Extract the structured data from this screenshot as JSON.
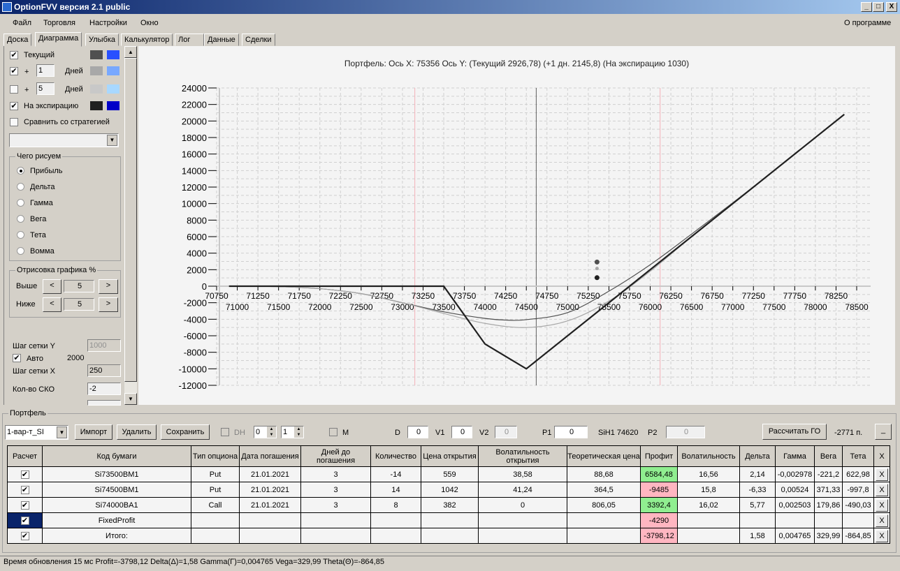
{
  "window": {
    "title": "OptionFVV версия 2.1 public",
    "min": "_",
    "max": "□",
    "close": "X"
  },
  "menu": [
    "Файл",
    "Торговля",
    "Настройки",
    "Окно"
  ],
  "menu_right": "О программе",
  "tabs": [
    "Доска",
    "Диаграмма",
    "Улыбка",
    "Калькулятор",
    "Лог",
    "Данные",
    "Сделки"
  ],
  "active_tab": "Диаграмма",
  "left": {
    "current": {
      "label": "Текущий",
      "checked": true,
      "color1": "#505050",
      "color2": "#2850ff"
    },
    "plus1": {
      "plus": "+",
      "value": "1",
      "unit": "Дней",
      "checked": true,
      "color1": "#a8a8a8",
      "color2": "#78a8ff"
    },
    "plus5": {
      "plus": "+",
      "value": "5",
      "unit": "Дней",
      "checked": false,
      "color1": "#c8c8c8",
      "color2": "#a8d8ff"
    },
    "expiry": {
      "label": "На экспирацию",
      "checked": true,
      "color1": "#202020",
      "color2": "#0000c8"
    },
    "compare": {
      "label": "Сравнить со стратегией",
      "checked": false
    },
    "what_title": "Чего рисуем",
    "what": [
      {
        "label": "Прибыль",
        "selected": true
      },
      {
        "label": "Дельта"
      },
      {
        "label": "Гамма"
      },
      {
        "label": "Вега"
      },
      {
        "label": "Тета"
      },
      {
        "label": "Вомма"
      }
    ],
    "draw_title": "Отрисовка графика %",
    "above": {
      "label": "Выше",
      "value": "5"
    },
    "below": {
      "label": "Ниже",
      "value": "5"
    },
    "prev": "<",
    "next": ">",
    "grid_y_label": "Шаг сетки Y",
    "grid_y": "1000",
    "auto_label": "Авто",
    "auto_value": "2000",
    "grid_x_label": "Шаг сетки X",
    "grid_x": "250",
    "sko_label": "Кол-во СКО",
    "sko": "-2"
  },
  "chart_data": {
    "type": "line",
    "title": "Портфель: Ось X: 75356 Ось Y:  (Текущий 2926,78)  (+1 дн. 2145,8)  (На экспирацию 1030)",
    "xlim": [
      70750,
      78500
    ],
    "ylim": [
      -12000,
      24000
    ],
    "xticks": [
      70750,
      71000,
      71250,
      71500,
      71750,
      72000,
      72250,
      72500,
      72750,
      73000,
      73250,
      73500,
      73750,
      74000,
      74250,
      74500,
      74750,
      75000,
      75250,
      75500,
      75750,
      76000,
      76250,
      76500,
      76750,
      77000,
      77250,
      77500,
      77750,
      78000,
      78250,
      78500
    ],
    "yticks": [
      24000,
      22000,
      20000,
      18000,
      16000,
      14000,
      12000,
      10000,
      8000,
      6000,
      4000,
      2000,
      0,
      -2000,
      -4000,
      -6000,
      -8000,
      -10000,
      -12000
    ],
    "grid": true,
    "series": [
      {
        "name": "Текущий",
        "color": "#505050",
        "points": [
          [
            70900,
            0
          ],
          [
            71500,
            -50
          ],
          [
            72000,
            -300
          ],
          [
            72500,
            -900
          ],
          [
            73000,
            -2000
          ],
          [
            73500,
            -3100
          ],
          [
            74000,
            -3900
          ],
          [
            74250,
            -4100
          ],
          [
            74500,
            -4050
          ],
          [
            75000,
            -3200
          ],
          [
            75500,
            -600
          ],
          [
            76000,
            2600
          ],
          [
            76500,
            6300
          ],
          [
            77000,
            10100
          ],
          [
            77500,
            14000
          ],
          [
            78350,
            20800
          ]
        ]
      },
      {
        "name": "+1 дн.",
        "color": "#a8a8a8",
        "points": [
          [
            70900,
            0
          ],
          [
            71500,
            -50
          ],
          [
            72000,
            -300
          ],
          [
            72500,
            -900
          ],
          [
            73000,
            -2000
          ],
          [
            73500,
            -3300
          ],
          [
            74000,
            -4500
          ],
          [
            74500,
            -5000
          ],
          [
            75000,
            -4200
          ],
          [
            75500,
            -1800
          ],
          [
            76000,
            1800
          ],
          [
            76500,
            6000
          ],
          [
            77000,
            10050
          ],
          [
            77500,
            14000
          ],
          [
            78350,
            20800
          ]
        ]
      },
      {
        "name": "На экспирацию",
        "color": "#202020",
        "points": [
          [
            70900,
            0
          ],
          [
            73500,
            0
          ],
          [
            74000,
            -7000
          ],
          [
            74500,
            -10000
          ],
          [
            78350,
            20800
          ]
        ]
      }
    ],
    "cursor": {
      "x": 75356,
      "values": [
        2926.78,
        2145.8,
        1030
      ]
    },
    "underlying_price": 74620,
    "bounds": [
      73150,
      76120
    ]
  },
  "portfolio": {
    "title": "Портфель",
    "selected": "1-вар-т_SI",
    "import": "Импорт",
    "delete": "Удалить",
    "save": "Сохранить",
    "dh": "DH",
    "spin1": "0",
    "spin2": "1",
    "m": "M",
    "d_label": "D",
    "d": "0",
    "v1_label": "V1",
    "v1": "0",
    "v2_label": "V2",
    "v2": "0",
    "p1_label": "P1",
    "p1": "0",
    "instrument": "SiH1 74620",
    "p2_label": "P2",
    "p2": "0",
    "calc": "Рассчитать ГО",
    "go": "-2771 п.",
    "min": "_"
  },
  "table": {
    "headers": [
      "Расчет",
      "Код бумаги",
      "Тип опциона",
      "Дата погашения",
      "Дней до погашения",
      "Количество",
      "Цена открытия",
      "Волатильность открытия",
      "Теоретическая цена",
      "Профит",
      "Волатильность",
      "Дельта",
      "Гамма",
      "Вега",
      "Тета",
      "X"
    ],
    "rows": [
      [
        "✔",
        "Si73500BM1",
        "Put",
        "21.01.2021",
        "3",
        "-14",
        "559",
        "38,58",
        "88,68",
        "6584,48",
        "16,56",
        "2,14",
        "-0,002978",
        "-221,2",
        "622,98",
        "X"
      ],
      [
        "✔",
        "Si74500BM1",
        "Put",
        "21.01.2021",
        "3",
        "14",
        "1042",
        "41,24",
        "364,5",
        "-9485",
        "15,8",
        "-6,33",
        "0,00524",
        "371,33",
        "-997,8",
        "X"
      ],
      [
        "✔",
        "Si74000BA1",
        "Call",
        "21.01.2021",
        "3",
        "8",
        "382",
        "0",
        "806,05",
        "3392,4",
        "16,02",
        "5,77",
        "0,002503",
        "179,86",
        "-490,03",
        "X"
      ],
      [
        "✔",
        "FixedProfit",
        "",
        "",
        "",
        "",
        "",
        "",
        "",
        "-4290",
        "",
        "",
        "",
        "",
        "",
        "X"
      ],
      [
        "✔",
        "Итого:",
        "",
        "",
        "",
        "",
        "",
        "",
        "",
        "-3798,12",
        "",
        "1,58",
        "0,004765",
        "329,99",
        "-864,85",
        "X"
      ]
    ],
    "profit_colors": [
      "#90ee90",
      "#ffb6c1",
      "#90ee90",
      "#ffb6c1",
      "#ffb6c1"
    ]
  },
  "status": "Время обновления 15 мс  Profit=-3798,12 Delta(Δ)=1,58 Gamma(Γ)=0,004765 Vega=329,99 Theta(Θ)=-864,85"
}
